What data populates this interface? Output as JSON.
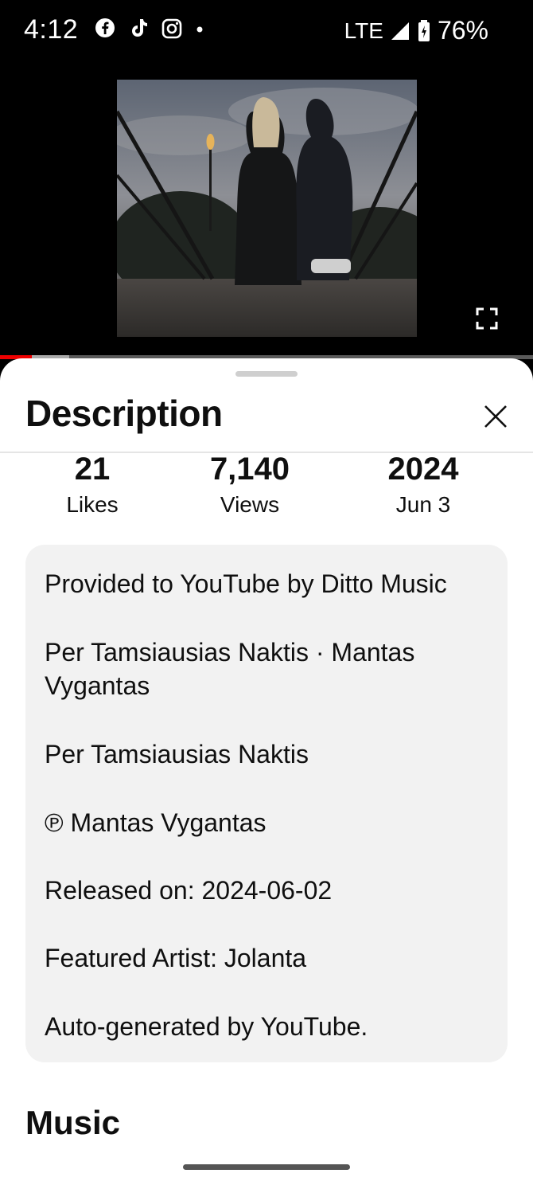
{
  "status_bar": {
    "time": "4:12",
    "notification_icons": [
      "facebook-icon",
      "tiktok-icon",
      "instagram-icon",
      "dot-icon"
    ],
    "network": "LTE",
    "battery": "76%"
  },
  "video": {
    "thumbnail": "couple-sitting-on-bridge",
    "progress": 0.06,
    "buffered": 0.13
  },
  "description_sheet": {
    "title": "Description",
    "stats": [
      {
        "value": "21",
        "label": "Likes"
      },
      {
        "value": "7,140",
        "label": "Views"
      },
      {
        "value": "2024",
        "label": "Jun 3"
      }
    ],
    "description_lines": [
      "Provided to YouTube by Ditto Music",
      "Per Tamsiausias Naktis · Mantas Vygantas",
      "Per Tamsiausias Naktis",
      "℗ Mantas Vygantas",
      "Released on: 2024-06-02",
      "Featured  Artist: Jolanta",
      "Auto-generated by YouTube."
    ],
    "section_heading": "Music"
  },
  "colors": {
    "progress": "#ee0000",
    "sheet_background": "#ffffff",
    "description_box": "#f2f2f2"
  }
}
